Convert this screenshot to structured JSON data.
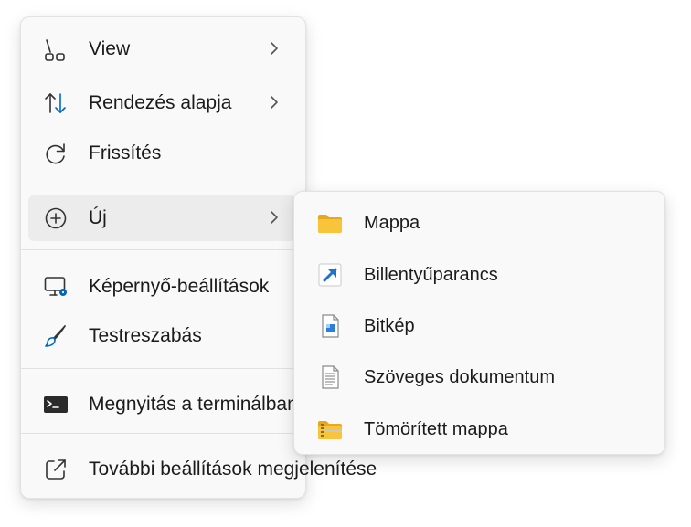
{
  "context_menu": {
    "items": [
      {
        "label": "View",
        "icon": "view-icon",
        "has_submenu": true
      },
      {
        "label": "Rendezés alapja",
        "icon": "sort-icon",
        "has_submenu": true
      },
      {
        "label": "Frissítés",
        "icon": "refresh-icon",
        "has_submenu": false
      },
      {
        "label": "Új",
        "icon": "new-plus-icon",
        "has_submenu": true
      },
      {
        "label": "Képernyő-beállítások",
        "icon": "display-settings-icon",
        "has_submenu": false
      },
      {
        "label": "Testreszabás",
        "icon": "brush-icon",
        "has_submenu": false
      },
      {
        "label": "Megnyitás a terminálban",
        "icon": "terminal-icon",
        "has_submenu": false
      },
      {
        "label": "További beállítások megjelenítése",
        "icon": "share-open-icon",
        "has_submenu": false
      }
    ]
  },
  "new_submenu": {
    "items": [
      {
        "label": "Mappa",
        "icon": "folder-icon"
      },
      {
        "label": "Billentyűparancs",
        "icon": "shortcut-icon"
      },
      {
        "label": "Bitkép",
        "icon": "bitmap-icon"
      },
      {
        "label": "Szöveges dokumentum",
        "icon": "text-document-icon"
      },
      {
        "label": "Tömörített mappa",
        "icon": "zip-folder-icon"
      }
    ]
  },
  "colors": {
    "accent": "#0067c0",
    "menu_bg": "#f9f9f9",
    "hover_bg": "#ececec",
    "folder_yellow": "#f8c43a"
  }
}
